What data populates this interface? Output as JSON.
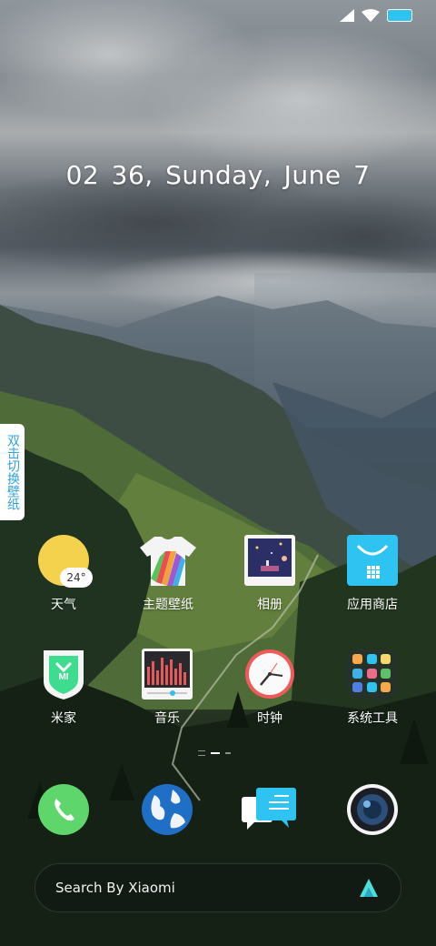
{
  "status_bar": {
    "signal_icon": "signal-icon",
    "wifi_icon": "wifi-icon",
    "battery_icon": "battery-icon",
    "battery_color": "#2fc3f1"
  },
  "clock": {
    "hour": "02",
    "minute": "36,",
    "day": "Sunday,",
    "month": "June",
    "date": "7"
  },
  "side_tab": {
    "label": "双击切换壁纸"
  },
  "apps": [
    {
      "label": "天气",
      "icon": "weather-icon",
      "temp": "24°"
    },
    {
      "label": "主题壁纸",
      "icon": "theme-icon"
    },
    {
      "label": "相册",
      "icon": "gallery-icon"
    },
    {
      "label": "应用商店",
      "icon": "app-store-icon"
    },
    {
      "label": "米家",
      "icon": "mi-home-icon"
    },
    {
      "label": "音乐",
      "icon": "music-icon"
    },
    {
      "label": "时钟",
      "icon": "clock-icon"
    },
    {
      "label": "系统工具",
      "icon": "system-tools-folder-icon"
    }
  ],
  "dock": [
    {
      "icon": "phone-icon"
    },
    {
      "icon": "browser-icon"
    },
    {
      "icon": "messages-icon"
    },
    {
      "icon": "camera-icon"
    }
  ],
  "search": {
    "placeholder": "Search By Xiaomi",
    "logo_icon": "xiao-ai-logo-icon"
  },
  "colors": {
    "accent": "#2fc3f1",
    "weather_sun": "#f5d24e",
    "side_tab_text": "#2fa3e0"
  }
}
